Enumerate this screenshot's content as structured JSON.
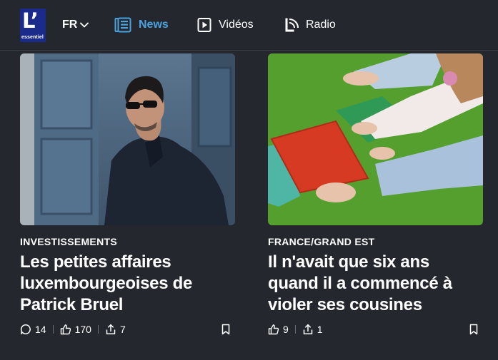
{
  "brand": {
    "logo_letter": "L’",
    "logo_sub": "essentiel"
  },
  "header": {
    "language": "FR",
    "nav": [
      {
        "label": "News",
        "icon": "news-icon",
        "active": true
      },
      {
        "label": "Vidéos",
        "icon": "play-icon",
        "active": false
      },
      {
        "label": "Radio",
        "icon": "radio-icon",
        "active": false
      }
    ]
  },
  "articles": [
    {
      "category": "INVESTISSEMENTS",
      "title": "Les petites affaires luxembourgeoises de Patrick Bruel",
      "comments": "14",
      "likes": "170",
      "shares": "7"
    },
    {
      "category": "FRANCE/GRAND EST",
      "title": "Il n'avait que six ans quand il a commencé à violer ses cousines",
      "likes": "9",
      "shares": "1"
    }
  ],
  "colors": {
    "background": "#24272e",
    "accent": "#4aa3df",
    "logo": "#1b2b8c"
  }
}
